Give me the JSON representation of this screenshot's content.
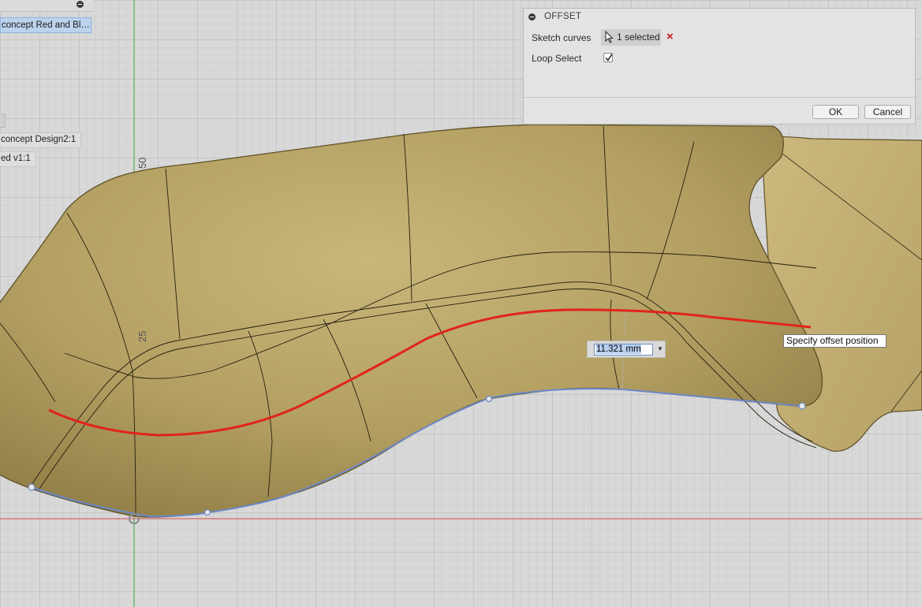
{
  "browser": {
    "selected_item": "concept Red and Bl…",
    "row_design": "concept Design2:1",
    "row_v1": "ed v1:1"
  },
  "viewport": {
    "grid_label_50": "50",
    "grid_label_25": "25",
    "tooltip": "Specify offset position",
    "dimension": {
      "value": "11.321 mm"
    },
    "colors": {
      "body": "#b5a166",
      "offset_curve": "#e1241a",
      "selected_curve": "#6b88c8",
      "grid": "#bdbdbd"
    }
  },
  "offset_dialog": {
    "title": "OFFSET",
    "sketch_curves_label": "Sketch curves",
    "sketch_curves_value": "1 selected",
    "clear_icon": "×",
    "loop_select_label": "Loop Select",
    "loop_select_checked": true,
    "ok_label": "OK",
    "cancel_label": "Cancel"
  }
}
